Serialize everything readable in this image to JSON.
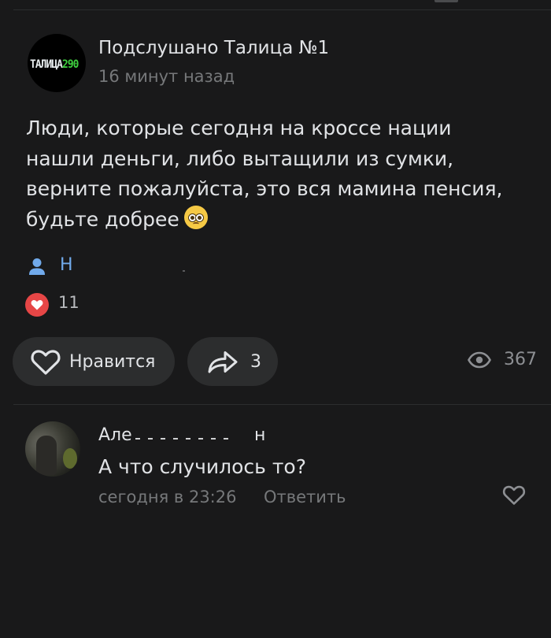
{
  "colors": {
    "background": "#19191a",
    "pill": "#2c2d2e",
    "text": "#e1e3e6",
    "secondary": "#76787a",
    "link": "#71aaeb",
    "reaction_heart": "#e64646"
  },
  "post": {
    "group_name": "Подслушано Талица №1",
    "avatar_logo": "ТАЛИЦА",
    "avatar_logo_num": "290",
    "time": "16 минут назад",
    "text_lines": [
      "Люди, которые сегодня на кроссе нации",
      "нашли деньги, либо вытащили из сумки,",
      "верните пожалуйста, это вся мамина пенсия,",
      "будьте добрее"
    ],
    "author_visible": "Н",
    "reactions_count": "11"
  },
  "actions": {
    "like_label": "Нравится",
    "share_count": "3",
    "views_count": "367"
  },
  "comment": {
    "author_start": "Але",
    "author_end": "н",
    "text": "А что случилось то?",
    "time": "сегодня в 23:26",
    "reply_label": "Ответить"
  },
  "icons": {
    "author": "user-icon",
    "reaction": "heart-filled-icon",
    "like": "heart-outline-icon",
    "share": "share-arrow-icon",
    "views": "eye-icon",
    "comment_like": "heart-outline-icon"
  }
}
